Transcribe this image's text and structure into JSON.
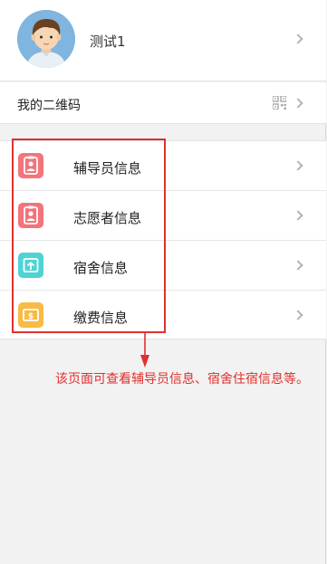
{
  "profile": {
    "name": "测试1"
  },
  "qr_row": {
    "label": "我的二维码"
  },
  "menu": {
    "items": [
      {
        "label": "辅导员信息",
        "icon": "contact-card-icon",
        "color": "#f3747a"
      },
      {
        "label": "志愿者信息",
        "icon": "contact-card-icon",
        "color": "#f3747a"
      },
      {
        "label": "宿舍信息",
        "icon": "dormitory-icon",
        "color": "#4fd3d3"
      },
      {
        "label": "缴费信息",
        "icon": "payment-icon",
        "color": "#f8bb43"
      }
    ]
  },
  "annotation": {
    "text": "该页面可查看辅导员信息、宿舍住宿信息等。",
    "color": "#e0302e"
  }
}
